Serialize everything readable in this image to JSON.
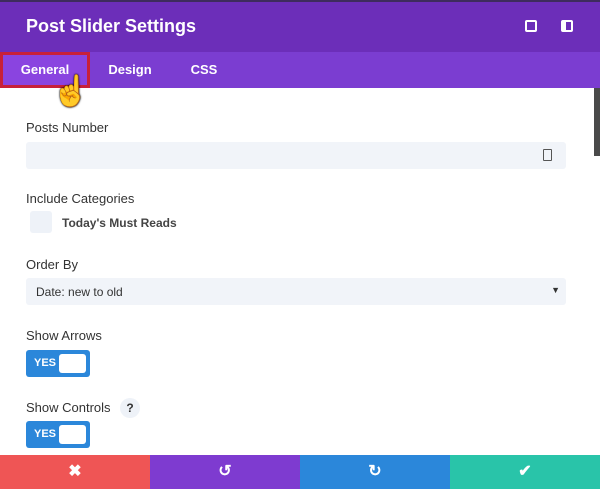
{
  "header": {
    "title": "Post Slider Settings",
    "icons": [
      "expand-icon",
      "sidebar-icon"
    ]
  },
  "tabs": [
    {
      "label": "General",
      "active": true
    },
    {
      "label": "Design"
    },
    {
      "label": "CSS"
    }
  ],
  "fields": {
    "posts_number": {
      "label": "Posts Number",
      "value": ""
    },
    "include_categories": {
      "label": "Include Categories",
      "option": "Today's Must Reads",
      "checked": false
    },
    "order_by": {
      "label": "Order By",
      "value": "Date: new to old"
    },
    "show_arrows": {
      "label": "Show Arrows",
      "toggle": "YES"
    },
    "show_controls": {
      "label": "Show Controls",
      "toggle": "YES",
      "help": "?"
    }
  },
  "footer": {
    "cancel": "✖",
    "undo": "↺",
    "redo": "↻",
    "save": "✔"
  },
  "colors": {
    "header": "#6c2eb9",
    "tabs": "#7b3dd1",
    "cancel": "#ef5555",
    "undo": "#7e3bd0",
    "redo": "#2b87da",
    "save": "#29c4a9"
  }
}
